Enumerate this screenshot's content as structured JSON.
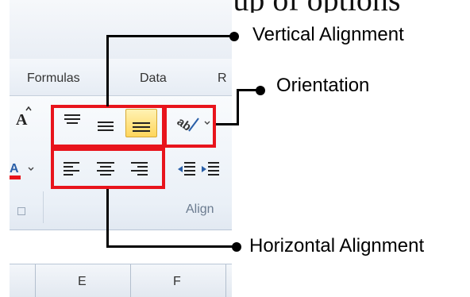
{
  "cropped_header_text": "ubgroup of options",
  "tabs": [
    "Formulas",
    "Data",
    "R"
  ],
  "group_label": "Align",
  "column_headers": [
    "E",
    "F"
  ],
  "callouts": {
    "vertical": "Vertical Alignment",
    "orientation": "Orientation",
    "horizontal": "Horizontal Alignment"
  },
  "icons": {
    "font_grow": "font-size-increase-icon",
    "font_color": "font-color-icon",
    "top_align": "align-top-icon",
    "middle_align": "align-middle-icon",
    "bottom_align": "align-bottom-icon",
    "orientation": "orientation-icon",
    "left_align": "align-left-icon",
    "center_align": "align-center-icon",
    "right_align": "align-right-icon",
    "decrease_indent": "decrease-indent-icon",
    "increase_indent": "increase-indent-icon"
  },
  "colors": {
    "highlight": "#e8141c",
    "active_button": "#ffd65c",
    "font_color_bar": "#e8141c"
  },
  "state": {
    "active_vertical_alignment": "bottom"
  }
}
